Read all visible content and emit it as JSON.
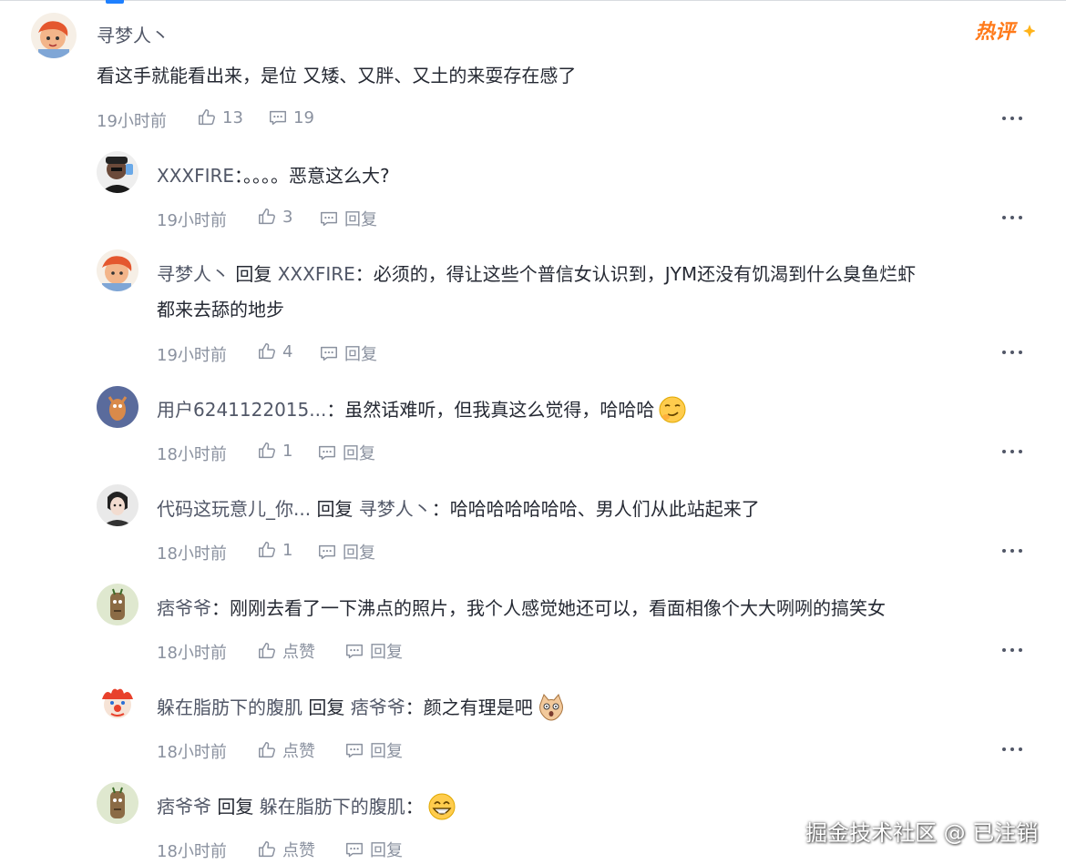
{
  "main_comment": {
    "author": "寻梦人丶",
    "text": "看这手就能看出来，是位 又矮、又胖、又土的来耍存在感了",
    "time": "19小时前",
    "likes": "13",
    "replies": "19",
    "hot_badge": "热评"
  },
  "replies": [
    {
      "author": "XXXFIRE",
      "reply_word": "",
      "target": "",
      "text": "：。。。。恶意这么大?",
      "time": "19小时前",
      "like": "3",
      "reply_label": "回复"
    },
    {
      "author": "寻梦人丶",
      "reply_word": "回复",
      "target": "XXXFIRE",
      "text": "：必须的，得让这些个普信女认识到，JYM还没有饥渴到什么臭鱼烂虾",
      "text2": "都来去舔的地步",
      "time": "19小时前",
      "like": "4",
      "reply_label": "回复"
    },
    {
      "author": "用户6241122015...",
      "reply_word": "",
      "target": "",
      "text": "：虽然话难听，但我真这么觉得，哈哈哈",
      "time": "18小时前",
      "like": "1",
      "reply_label": "回复"
    },
    {
      "author": "代码这玩意儿_你...",
      "reply_word": "回复",
      "target": "寻梦人丶",
      "text": "：哈哈哈哈哈哈哈、男人们从此站起来了",
      "time": "18小时前",
      "like": "1",
      "reply_label": "回复"
    },
    {
      "author": "痞爷爷",
      "reply_word": "",
      "target": "",
      "text": "：刚刚去看了一下沸点的照片，我个人感觉她还可以，看面相像个大大咧咧的搞笑女",
      "time": "18小时前",
      "like": "点赞",
      "reply_label": "回复"
    },
    {
      "author": "躲在脂肪下的腹肌",
      "reply_word": "回复",
      "target": "痞爷爷",
      "text": "：颜之有理是吧",
      "time": "18小时前",
      "like": "点赞",
      "reply_label": "回复"
    },
    {
      "author": "痞爷爷",
      "reply_word": "回复",
      "target": "躲在脂肪下的腹肌",
      "text": "：",
      "time": "18小时前",
      "like": "点赞",
      "reply_label": "回复"
    }
  ],
  "watermark": "掘金技术社区 @ 已注销",
  "icons": [
    "like-icon",
    "comment-icon",
    "more-icon",
    "hot-badge-icon"
  ],
  "colors": {
    "name": "#515767",
    "meta": "#8a919f",
    "text": "#252933",
    "hot": "#ff7a1a",
    "accent": "#1e80ff"
  }
}
